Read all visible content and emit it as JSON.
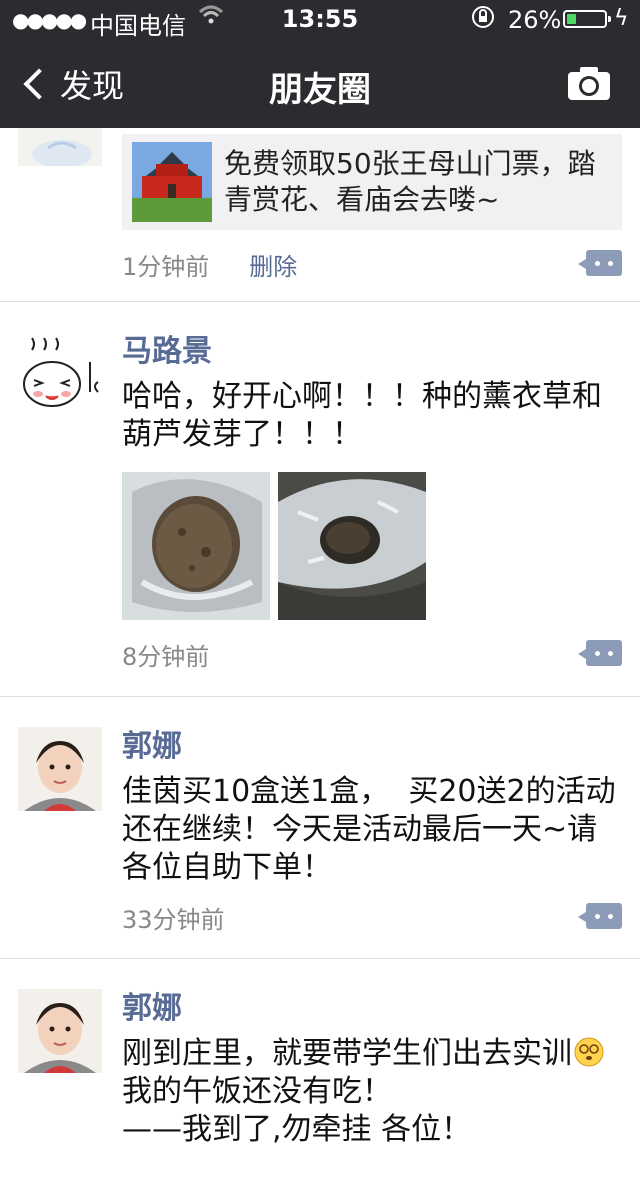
{
  "status_bar": {
    "carrier": "中国电信",
    "time": "13:55",
    "battery": "26%",
    "battery_level": 0.26
  },
  "nav": {
    "back_label": "发现",
    "title": "朋友圈"
  },
  "posts": [
    {
      "link_text": "免费领取50张王母山门票，踏青赏花、看庙会去喽~",
      "time": "1分钟前",
      "delete_label": "删除"
    },
    {
      "user": "马路景",
      "text": "哈哈，好开心啊！！！种的薰衣草和葫芦发芽了！！！",
      "time": "8分钟前"
    },
    {
      "user": "郭娜",
      "text": "佳茵买10盒送1盒，  买20送2的活动还在继续！今天是活动最后一天~请各位自助下单！",
      "time": "33分钟前"
    },
    {
      "user": "郭娜",
      "text_line1": "刚到庄里，就要带学生们出去实训",
      "text_line2": "我的午饭还没有吃！",
      "text_line3": "——我到了,勿牵挂  各位！"
    }
  ],
  "colors": {
    "nav_bg": "#2b2b30",
    "username": "#576b95",
    "battery_fill": "#4cd964"
  }
}
